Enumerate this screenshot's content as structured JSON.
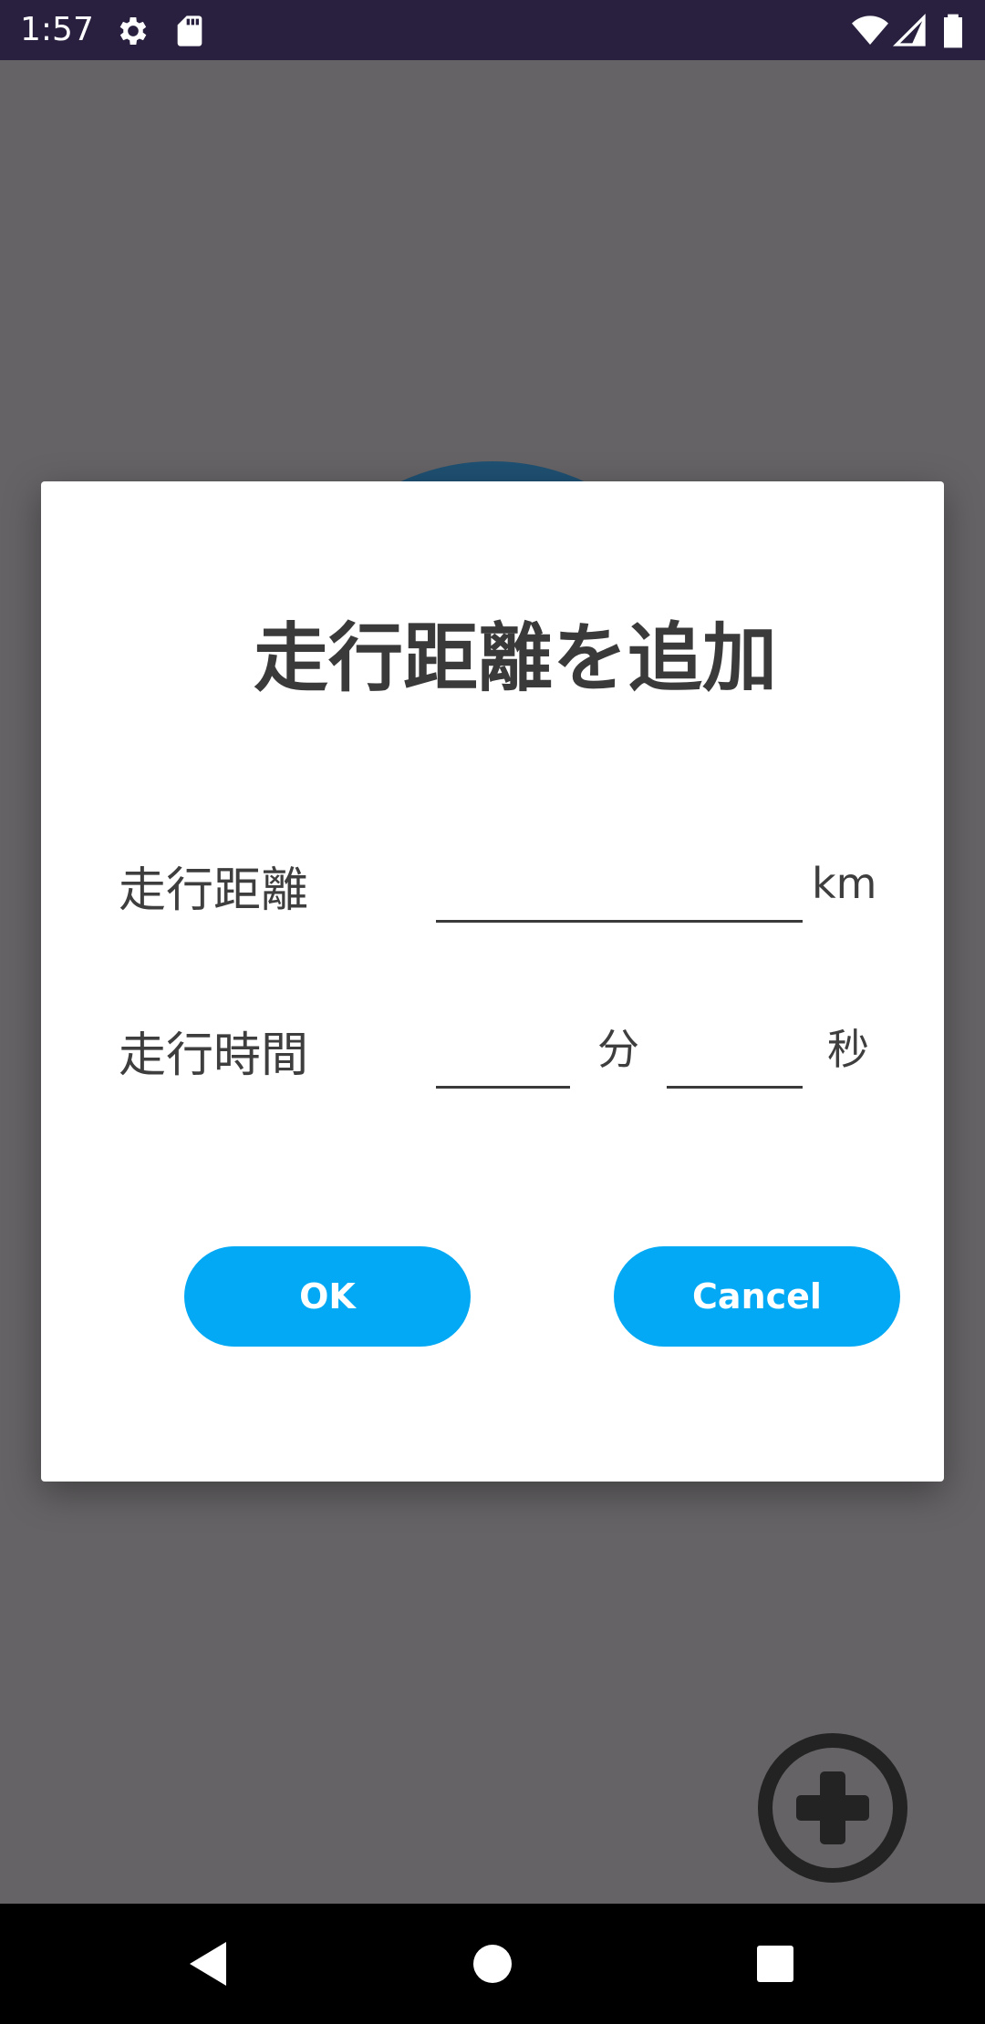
{
  "status_bar": {
    "time": "1:57",
    "icons": [
      "settings-icon",
      "sd-card-icon",
      "wifi-icon",
      "signal-icon",
      "battery-icon"
    ]
  },
  "background": {
    "image": "globe-image",
    "fab_icon": "add-circle-icon"
  },
  "dialog": {
    "title": "走行距離を追加",
    "distance": {
      "label": "走行距離",
      "value": "",
      "unit": "km"
    },
    "time": {
      "label": "走行時間",
      "minutes_value": "",
      "minutes_unit": "分",
      "seconds_value": "",
      "seconds_unit": "秒"
    },
    "buttons": {
      "ok": "OK",
      "cancel": "Cancel"
    },
    "accent_color": "#03a9f4"
  },
  "nav_bar": {
    "icons": [
      "back-icon",
      "home-icon",
      "recents-icon"
    ]
  }
}
